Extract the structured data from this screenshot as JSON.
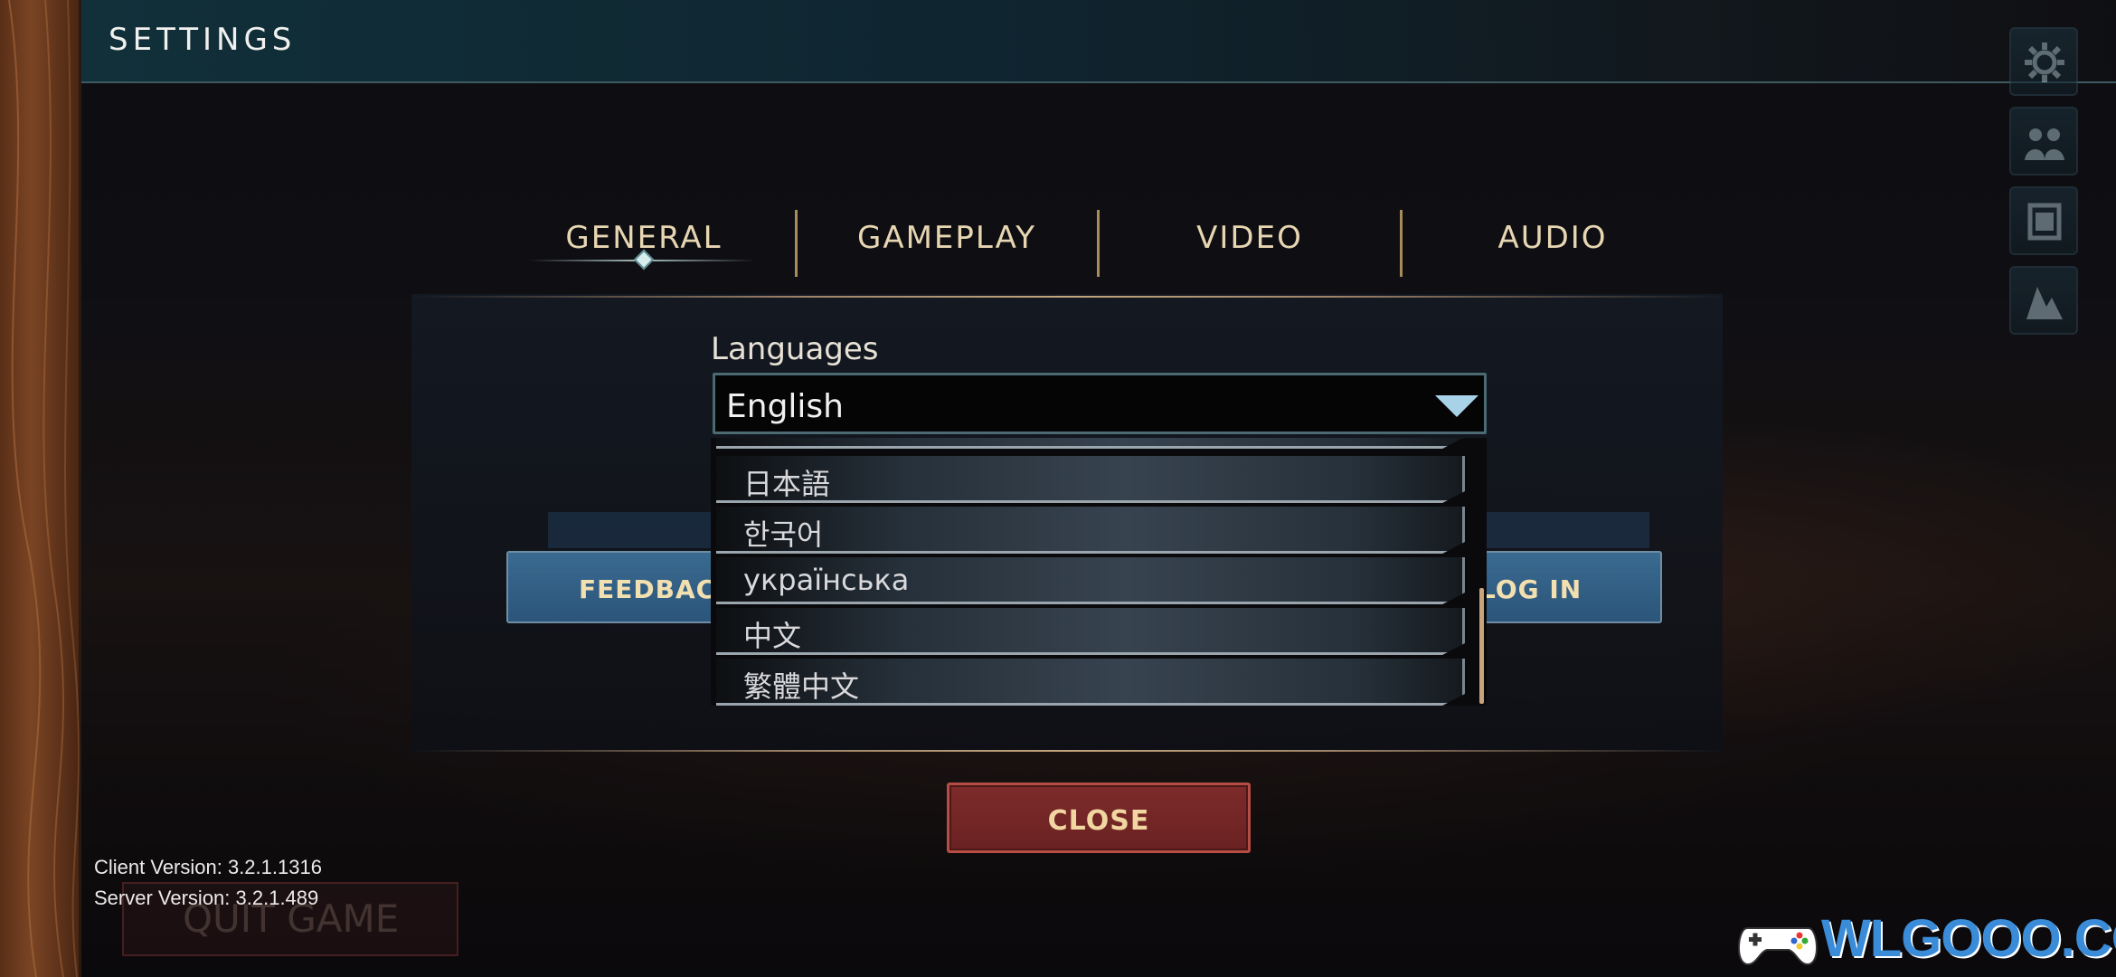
{
  "header": {
    "title": "SETTINGS"
  },
  "tabs": [
    {
      "label": "GENERAL",
      "active": true
    },
    {
      "label": "GAMEPLAY",
      "active": false
    },
    {
      "label": "VIDEO",
      "active": false
    },
    {
      "label": "AUDIO",
      "active": false
    }
  ],
  "side_menu": [
    {
      "icon": "gear-icon"
    },
    {
      "icon": "group-icon"
    },
    {
      "icon": "scroll-icon"
    },
    {
      "icon": "stats-icon"
    }
  ],
  "languages": {
    "label": "Languages",
    "selected": "English",
    "options": [
      "日本語",
      "한국어",
      "українська",
      "中文",
      "繁體中文"
    ]
  },
  "buttons": {
    "feedback": "FEEDBACK",
    "login": "LOG IN",
    "close": "CLOSE",
    "quit": "QUIT GAME"
  },
  "versions": {
    "client": "Client Version: 3.2.1.1316",
    "server": "Server Version: 3.2.1.489"
  },
  "watermark": "WLGOOO.COM",
  "colors": {
    "header_bg": "#11303a",
    "tab_text": "#e7d6b2",
    "close_button": "#7d2a2a",
    "blue_button": "#2b557a",
    "dropdown_arrow": "#a7d2e8"
  }
}
